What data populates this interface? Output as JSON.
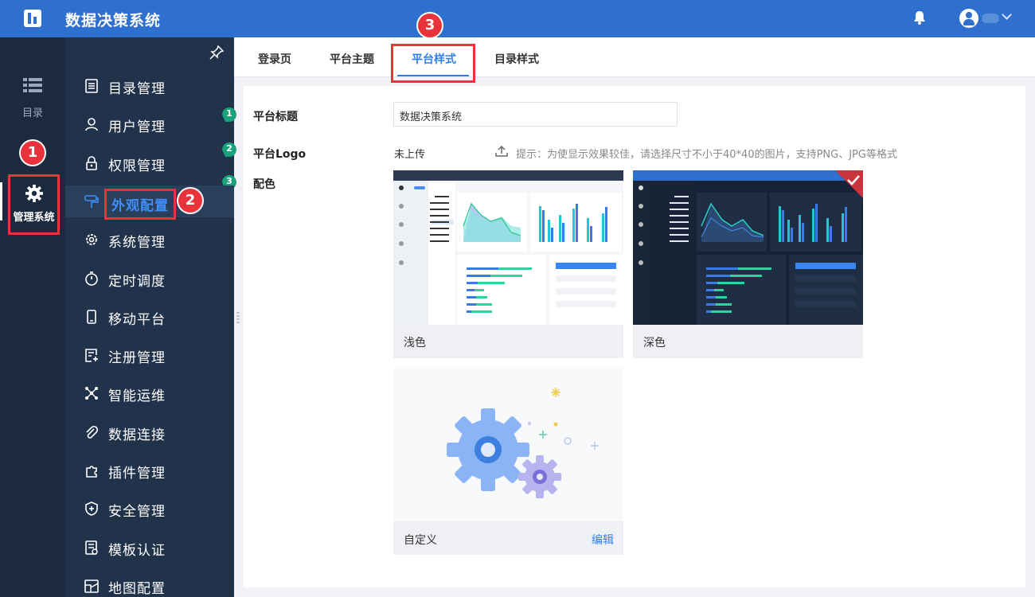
{
  "app": {
    "title": "数据决策系统"
  },
  "rail": {
    "directory_label": "目录",
    "admin_label": "管理系统"
  },
  "sidebar": {
    "items": [
      {
        "label": "目录管理",
        "icon": "list-doc-icon"
      },
      {
        "label": "用户管理",
        "icon": "user-icon"
      },
      {
        "label": "权限管理",
        "icon": "lock-icon"
      },
      {
        "label": "外观配置",
        "icon": "brush-icon"
      },
      {
        "label": "系统管理",
        "icon": "gear-icon"
      },
      {
        "label": "定时调度",
        "icon": "stopwatch-icon"
      },
      {
        "label": "移动平台",
        "icon": "mobile-icon"
      },
      {
        "label": "注册管理",
        "icon": "register-icon"
      },
      {
        "label": "智能运维",
        "icon": "network-icon"
      },
      {
        "label": "数据连接",
        "icon": "paperclip-icon"
      },
      {
        "label": "插件管理",
        "icon": "puzzle-icon"
      },
      {
        "label": "安全管理",
        "icon": "shield-icon"
      },
      {
        "label": "模板认证",
        "icon": "certificate-icon"
      },
      {
        "label": "地图配置",
        "icon": "map-icon"
      }
    ],
    "active_index": 3
  },
  "tabs": [
    {
      "label": "登录页"
    },
    {
      "label": "平台主题"
    },
    {
      "label": "平台样式"
    },
    {
      "label": "目录样式"
    }
  ],
  "form": {
    "platform_title_label": "平台标题",
    "platform_title_value": "数据决策系统",
    "platform_logo_label": "平台Logo",
    "logo_status": "未上传",
    "logo_hint": "提示：为使显示效果较佳，请选择尺寸不小于40*40的图片，支持PNG、JPG等格式",
    "color_label": "配色"
  },
  "themes": [
    {
      "caption": "浅色",
      "selected": false
    },
    {
      "caption": "深色",
      "selected": true
    },
    {
      "caption": "自定义",
      "action": "编辑"
    }
  ],
  "annotations": {
    "badges": [
      "1",
      "2",
      "3"
    ],
    "steps": [
      "1",
      "2",
      "3"
    ]
  },
  "colors": {
    "topbar": "#2f6fce",
    "rail": "#1b2a3f",
    "sidebar": "#21324b",
    "accent": "#2f80ed",
    "highlight_box": "#e8333a",
    "step_green": "#1aa37a"
  }
}
